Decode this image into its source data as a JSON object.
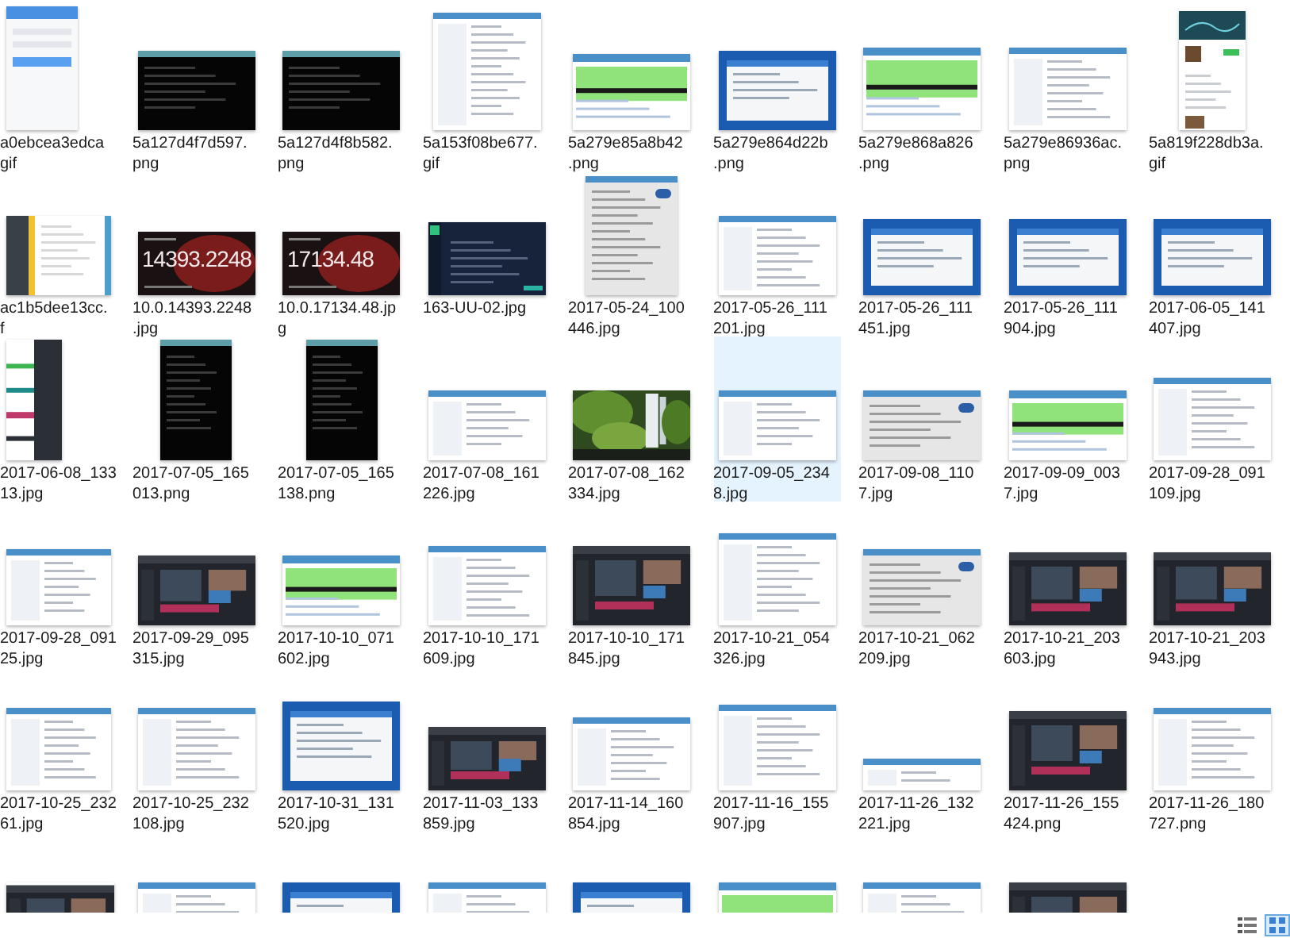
{
  "files": [
    {
      "label_lines": [
        "a0ebcea3edca",
        "gif"
      ],
      "selected": false
    },
    {
      "label_lines": [
        "5a127d4f7d597.",
        "png"
      ],
      "selected": false
    },
    {
      "label_lines": [
        "5a127d4f8b582.",
        "png"
      ],
      "selected": false
    },
    {
      "label_lines": [
        "5a153f08be677.",
        "gif"
      ],
      "selected": false
    },
    {
      "label_lines": [
        "5a279e85a8b42",
        ".png"
      ],
      "selected": false
    },
    {
      "label_lines": [
        "5a279e864d22b",
        ".png"
      ],
      "selected": false
    },
    {
      "label_lines": [
        "5a279e868a826",
        ".png"
      ],
      "selected": false
    },
    {
      "label_lines": [
        "5a279e86936ac.",
        "png"
      ],
      "selected": false
    },
    {
      "label_lines": [
        "5a819f228db3a.",
        "gif"
      ],
      "selected": false
    },
    {
      "label_lines": [
        "ac1b5dee13cc.",
        "f"
      ],
      "selected": false
    },
    {
      "label_lines": [
        "10.0.14393.2248",
        ".jpg"
      ],
      "selected": false,
      "preview_text": "14393.2248"
    },
    {
      "label_lines": [
        "10.0.17134.48.jp",
        "g"
      ],
      "selected": false,
      "preview_text": "17134.48"
    },
    {
      "label_lines": [
        "163-UU-02.jpg"
      ],
      "selected": false
    },
    {
      "label_lines": [
        "2017-05-24_100",
        "446.jpg"
      ],
      "selected": false
    },
    {
      "label_lines": [
        "2017-05-26_111",
        "201.jpg"
      ],
      "selected": false
    },
    {
      "label_lines": [
        "2017-05-26_111",
        "451.jpg"
      ],
      "selected": false
    },
    {
      "label_lines": [
        "2017-05-26_111",
        "904.jpg"
      ],
      "selected": false
    },
    {
      "label_lines": [
        "2017-06-05_141",
        "407.jpg"
      ],
      "selected": false
    },
    {
      "label_lines": [
        "2017-06-08_133",
        "13.jpg"
      ],
      "selected": false
    },
    {
      "label_lines": [
        "2017-07-05_165",
        "013.png"
      ],
      "selected": false
    },
    {
      "label_lines": [
        "2017-07-05_165",
        "138.png"
      ],
      "selected": false
    },
    {
      "label_lines": [
        "2017-07-08_161",
        "226.jpg"
      ],
      "selected": false
    },
    {
      "label_lines": [
        "2017-07-08_162",
        "334.jpg"
      ],
      "selected": false
    },
    {
      "label_lines": [
        "2017-09-05_234",
        "8.jpg"
      ],
      "selected": true
    },
    {
      "label_lines": [
        "2017-09-08_110",
        "7.jpg"
      ],
      "selected": false
    },
    {
      "label_lines": [
        "2017-09-09_003",
        "7.jpg"
      ],
      "selected": false
    },
    {
      "label_lines": [
        "2017-09-28_091",
        "109.jpg"
      ],
      "selected": false
    },
    {
      "label_lines": [
        "2017-09-28_091",
        "25.jpg"
      ],
      "selected": false
    },
    {
      "label_lines": [
        "2017-09-29_095",
        "315.jpg"
      ],
      "selected": false
    },
    {
      "label_lines": [
        "2017-10-10_071",
        "602.jpg"
      ],
      "selected": false
    },
    {
      "label_lines": [
        "2017-10-10_171",
        "609.jpg"
      ],
      "selected": false
    },
    {
      "label_lines": [
        "2017-10-10_171",
        "845.jpg"
      ],
      "selected": false
    },
    {
      "label_lines": [
        "2017-10-21_054",
        "326.jpg"
      ],
      "selected": false
    },
    {
      "label_lines": [
        "2017-10-21_062",
        "209.jpg"
      ],
      "selected": false
    },
    {
      "label_lines": [
        "2017-10-21_203",
        "603.jpg"
      ],
      "selected": false
    },
    {
      "label_lines": [
        "2017-10-21_203",
        "943.jpg"
      ],
      "selected": false
    },
    {
      "label_lines": [
        "2017-10-25_232",
        "61.jpg"
      ],
      "selected": false
    },
    {
      "label_lines": [
        "2017-10-25_232",
        "108.jpg"
      ],
      "selected": false
    },
    {
      "label_lines": [
        "2017-10-31_131",
        "520.jpg"
      ],
      "selected": false
    },
    {
      "label_lines": [
        "2017-11-03_133",
        "859.jpg"
      ],
      "selected": false
    },
    {
      "label_lines": [
        "2017-11-14_160",
        "854.jpg"
      ],
      "selected": false
    },
    {
      "label_lines": [
        "2017-11-16_155",
        "907.jpg"
      ],
      "selected": false
    },
    {
      "label_lines": [
        "2017-11-26_132",
        "221.jpg"
      ],
      "selected": false
    },
    {
      "label_lines": [
        "2017-11-26_155",
        "424.png"
      ],
      "selected": false
    },
    {
      "label_lines": [
        "2017-11-26_180",
        "727.png"
      ],
      "selected": false
    },
    {
      "selected": false
    },
    {
      "selected": false
    },
    {
      "selected": false
    },
    {
      "selected": false
    },
    {
      "selected": false
    },
    {
      "selected": false
    },
    {
      "selected": false
    },
    {
      "selected": false
    }
  ],
  "view_buttons": [
    {
      "selected": false
    },
    {
      "selected": true
    }
  ]
}
